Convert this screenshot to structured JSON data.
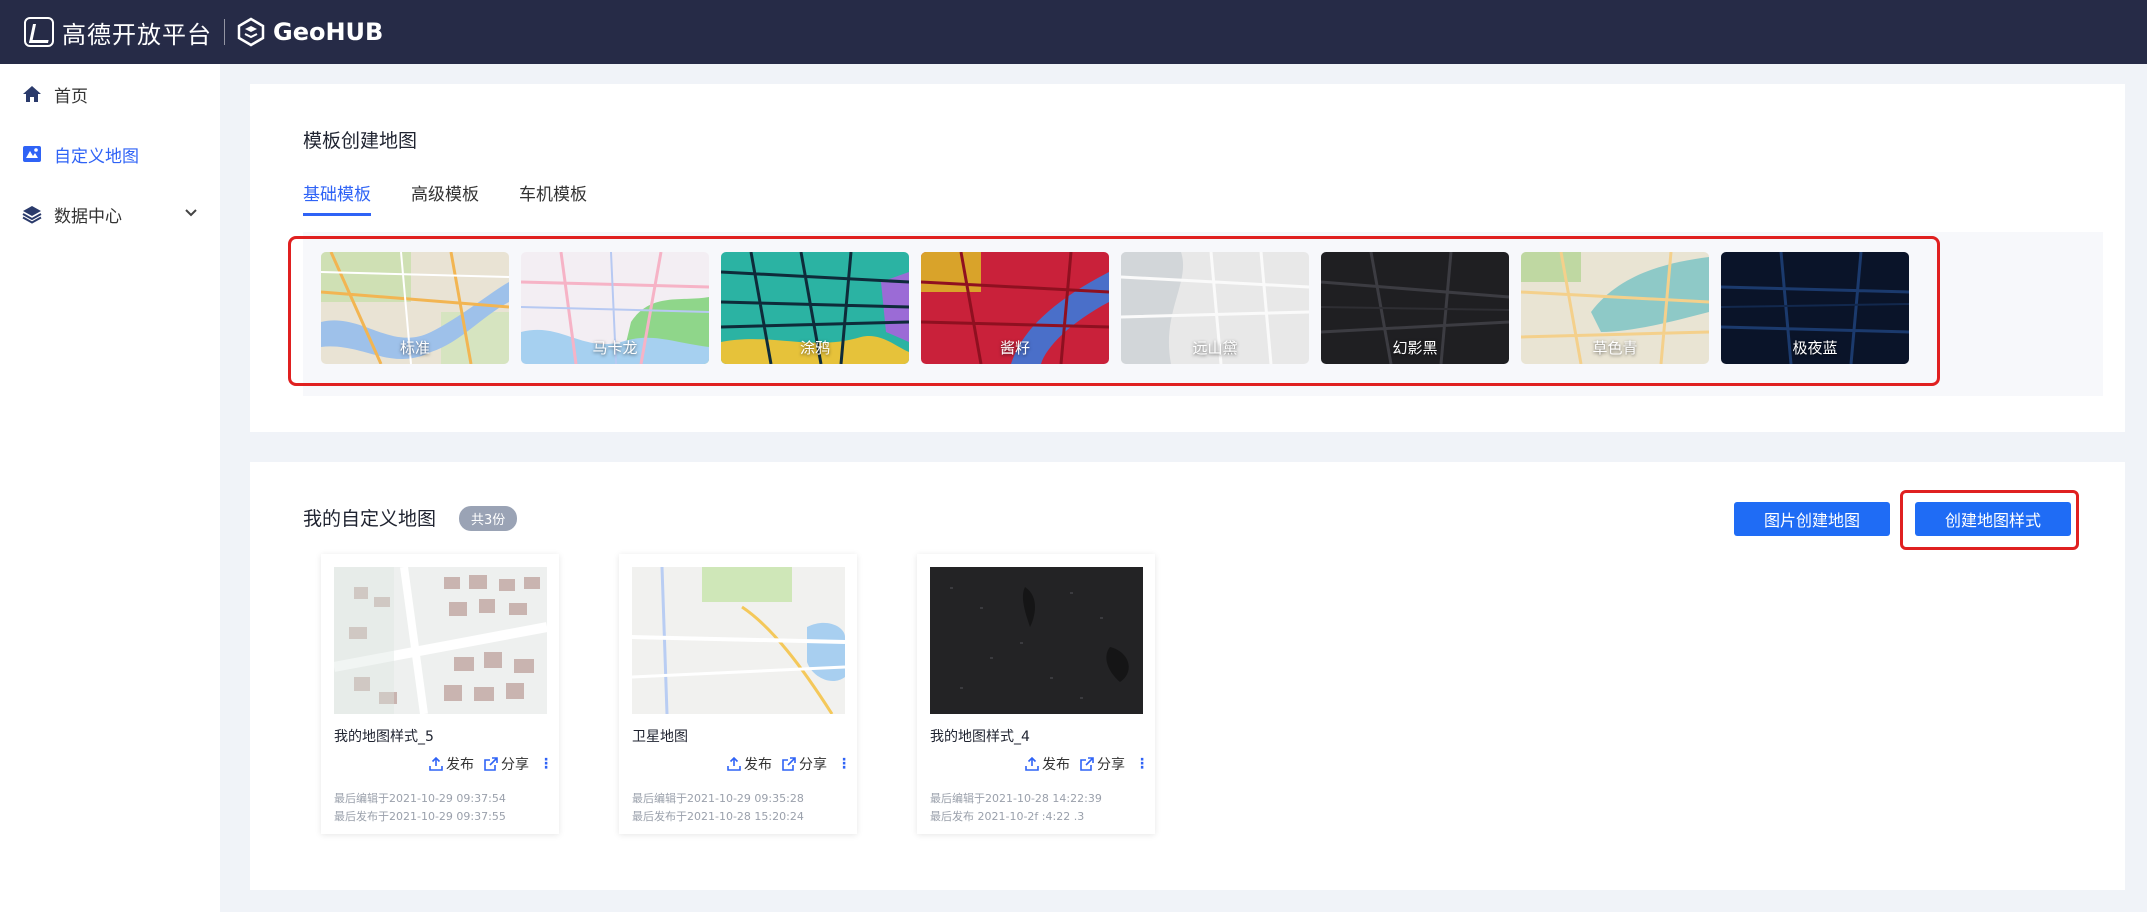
{
  "topbar": {
    "brand": "高德开放平台",
    "product": "GeoHUB"
  },
  "sidebar": {
    "items": [
      {
        "label": "首页",
        "icon": "home-icon"
      },
      {
        "label": "自定义地图",
        "icon": "custom-map-icon",
        "active": true
      },
      {
        "label": "数据中心",
        "icon": "layers-icon",
        "expandable": true
      }
    ]
  },
  "templates": {
    "title": "模板创建地图",
    "tabs": [
      {
        "label": "基础模板",
        "active": true
      },
      {
        "label": "高级模板"
      },
      {
        "label": "车机模板"
      }
    ],
    "items": [
      {
        "label": "标准",
        "theme": "standard"
      },
      {
        "label": "马卡龙",
        "theme": "macaron"
      },
      {
        "label": "涂鸦",
        "theme": "graffiti"
      },
      {
        "label": "酱籽",
        "theme": "jiangzi"
      },
      {
        "label": "远山黛",
        "theme": "yuanshandai"
      },
      {
        "label": "幻影黑",
        "theme": "phantom-black"
      },
      {
        "label": "草色青",
        "theme": "grass-green"
      },
      {
        "label": "极夜蓝",
        "theme": "polar-night-blue"
      }
    ]
  },
  "my_maps": {
    "title": "我的自定义地图",
    "count": "共3份",
    "image_create_label": "图片创建地图",
    "create_style_label": "创建地图样式",
    "cards": [
      {
        "name": "我的地图样式_5",
        "publish": "发布",
        "share": "分享",
        "edited": "最后编辑于2021-10-29 09:37:54",
        "published": "最后发布于2021-10-29 09:37:55",
        "theme": "light-buildings"
      },
      {
        "name": "卫星地图",
        "publish": "发布",
        "share": "分享",
        "edited": "最后编辑于2021-10-29 09:35:28",
        "published": "最后发布于2021-10-28 15:20:24",
        "theme": "light-roads"
      },
      {
        "name": "我的地图样式_4",
        "publish": "发布",
        "share": "分享",
        "edited": "最后编辑于2021-10-28 14:22:39",
        "published": "最后发布  2021-10-2f  :4:22  .3",
        "theme": "dark"
      }
    ]
  },
  "colors": {
    "accent": "#2f63f6",
    "button": "#1f6cf5",
    "topbar": "#262b47",
    "highlight": "#e02020"
  }
}
